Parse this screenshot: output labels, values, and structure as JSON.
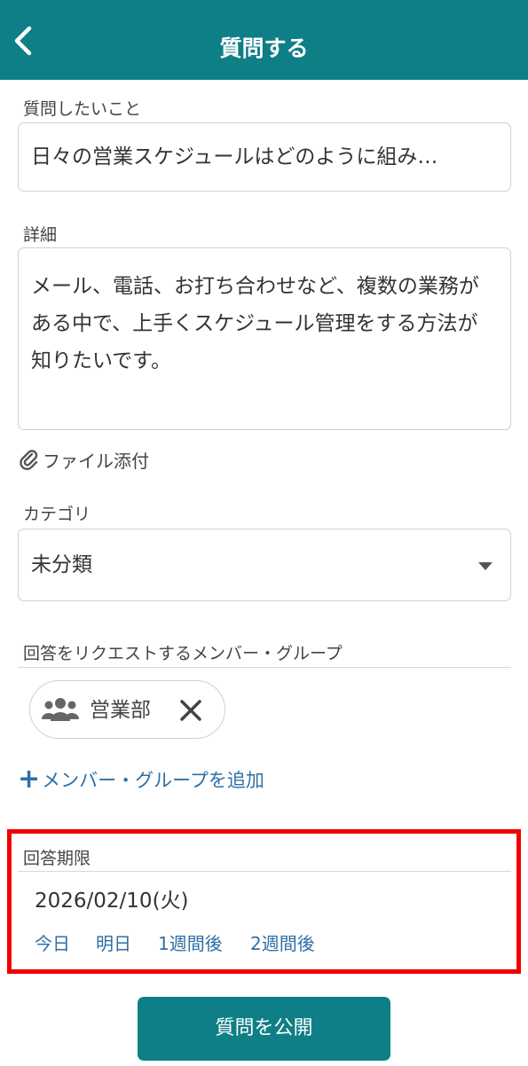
{
  "header": {
    "title": "質問する",
    "back_icon": "chevron-left-icon"
  },
  "question": {
    "label": "質問したいこと",
    "value": "日々の営業スケジュールはどのように組み…"
  },
  "detail": {
    "label": "詳細",
    "value": "メール、電話、お打ち合わせなど、複数の業務がある中で、上手くスケジュール管理をする方法が知りたいです。"
  },
  "attachment": {
    "label": "ファイル添付",
    "icon": "paperclip-icon"
  },
  "category": {
    "label": "カテゴリ",
    "selected": "未分類"
  },
  "request": {
    "label": "回答をリクエストするメンバー・グループ",
    "chips": [
      {
        "label": "営業部",
        "icon": "group-icon"
      }
    ],
    "add_label": "メンバー・グループを追加"
  },
  "deadline": {
    "label": "回答期限",
    "value": "2026/02/10(火)",
    "options": [
      "今日",
      "明日",
      "1週間後",
      "2週間後"
    ],
    "highlight_color": "#ee0000"
  },
  "publish_label": "質問を公開",
  "colors": {
    "primary": "#0e7f86",
    "link": "#2f6fa6"
  }
}
